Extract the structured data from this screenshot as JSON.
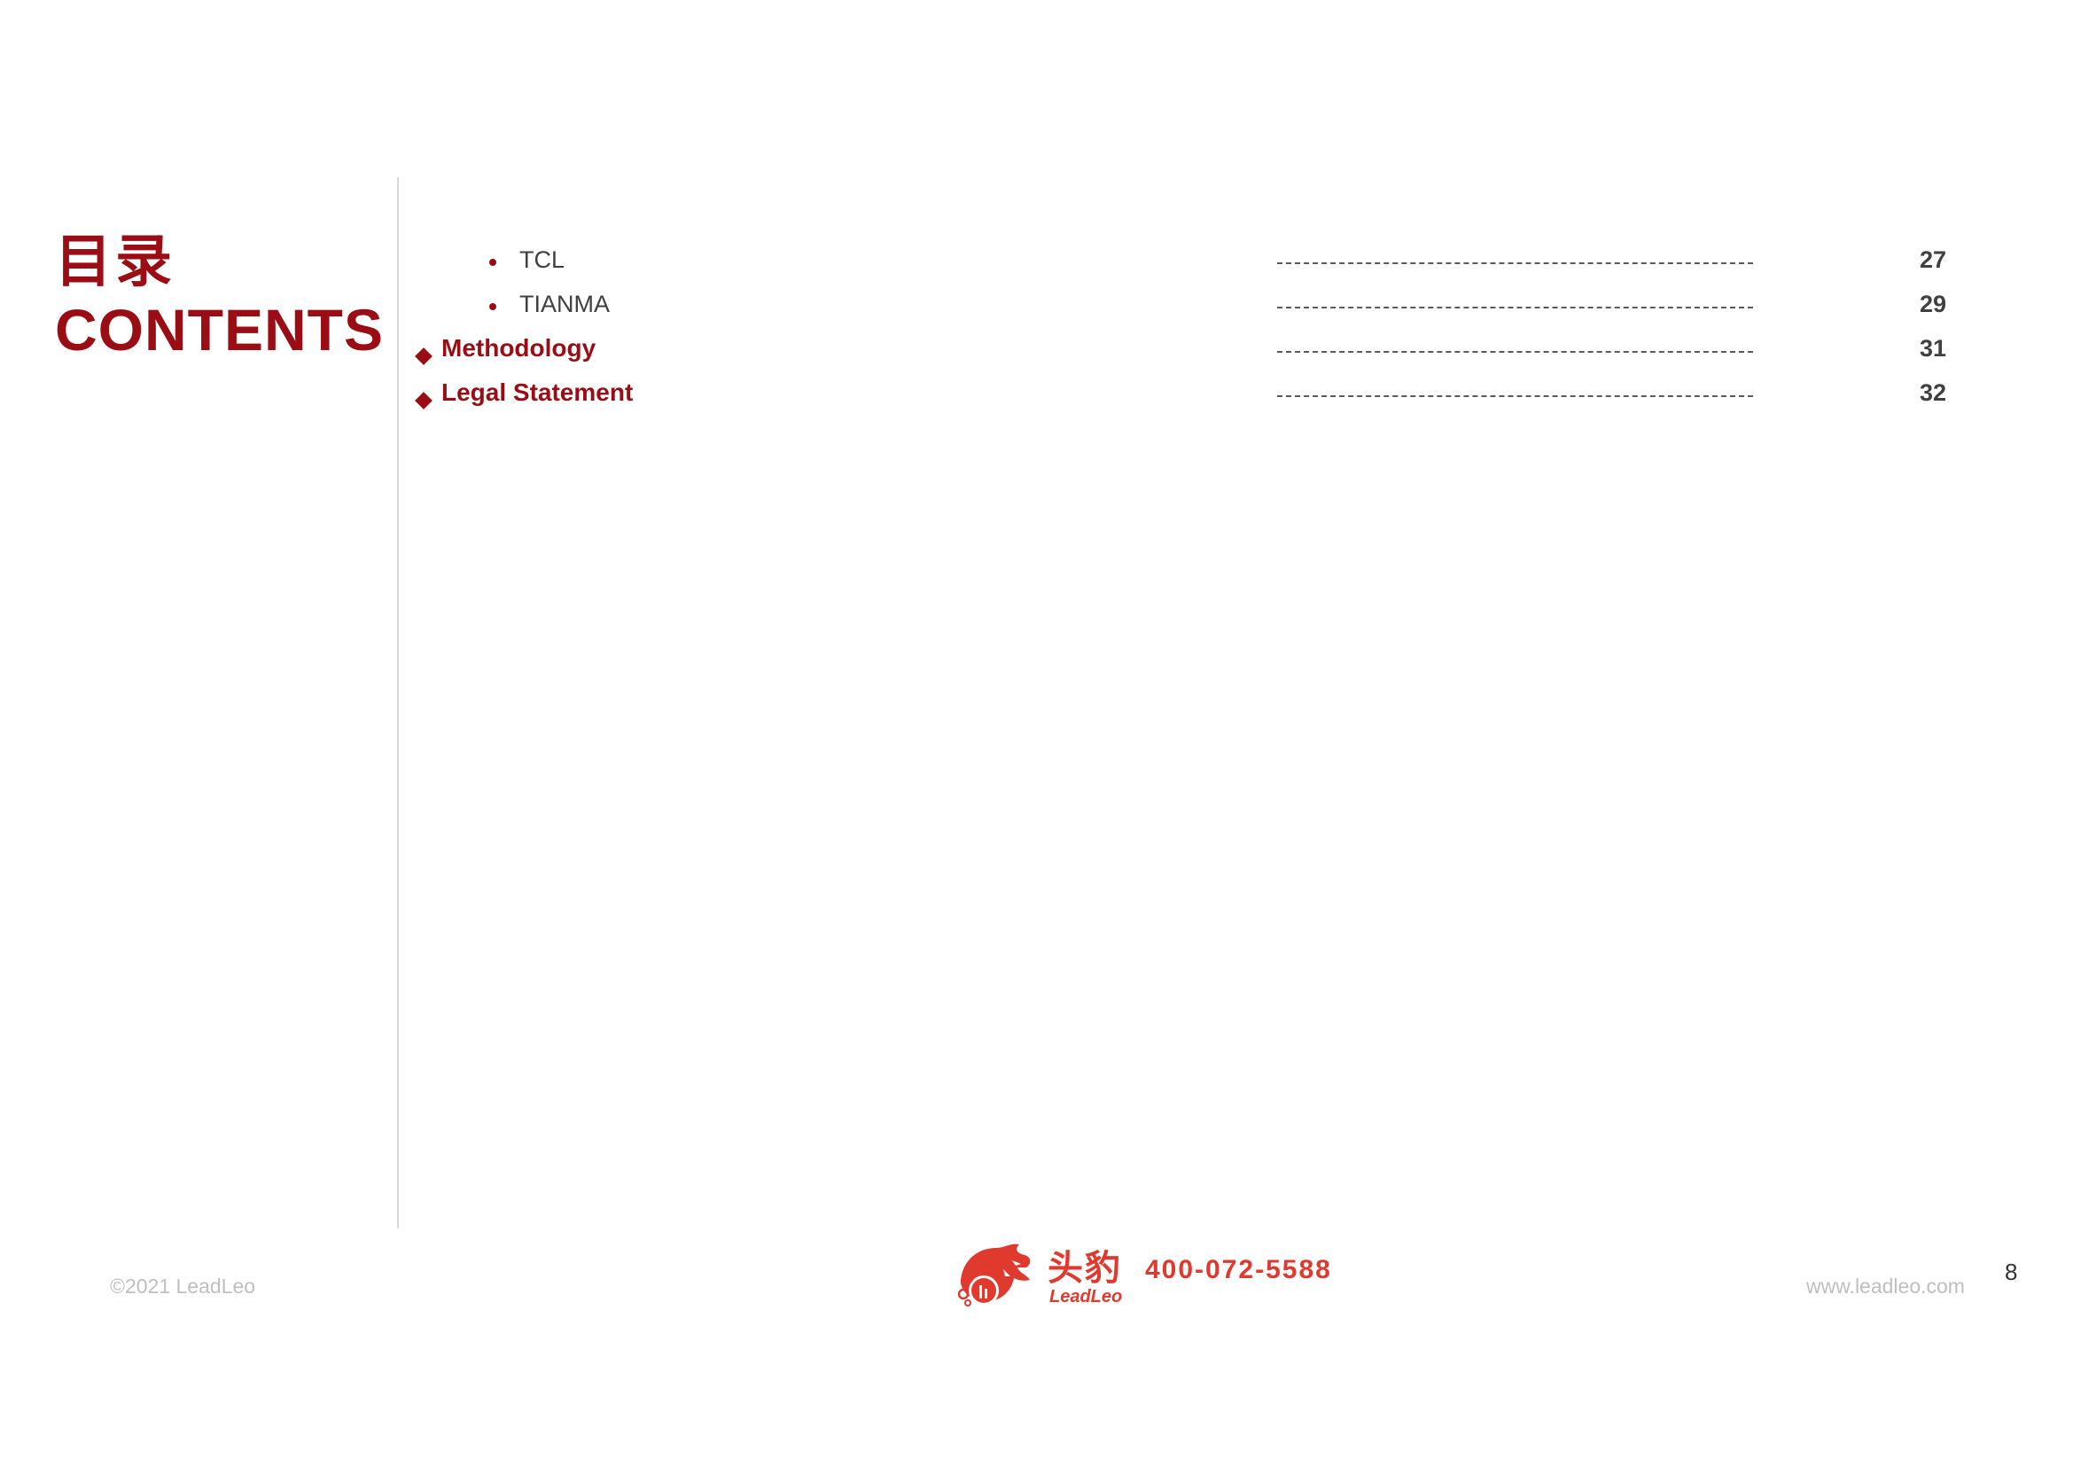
{
  "title": {
    "cn": "目录",
    "en": "CONTENTS"
  },
  "toc": [
    {
      "label": "TCL",
      "page": "27",
      "level": "sub"
    },
    {
      "label": "TIANMA",
      "page": "29",
      "level": "sub"
    },
    {
      "label": "Methodology",
      "page": "31",
      "level": "main"
    },
    {
      "label": "Legal Statement",
      "page": "32",
      "level": "main"
    }
  ],
  "footer": {
    "copyright": "©2021 LeadLeo",
    "brand_cn": "头豹",
    "brand_en": "LeadLeo",
    "phone": "400-072-5588",
    "website": "www.leadleo.com",
    "page_number": "8"
  },
  "colors": {
    "accent": "#9b0d14",
    "logo": "#e03a2f",
    "text": "#404040",
    "muted": "#bfbfbf"
  }
}
